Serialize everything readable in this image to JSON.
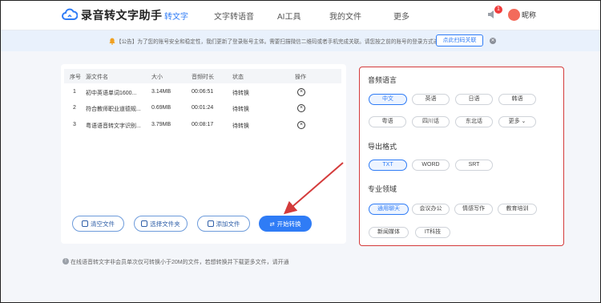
{
  "app": {
    "title": "录音转文字助手"
  },
  "nav": [
    "转文字",
    "文字转语音",
    "AI工具",
    "我的文件",
    "更多"
  ],
  "header": {
    "badge_count": "1",
    "nickname": "昵称"
  },
  "notice": {
    "text": "【公告】为了您的账号安全和稳定性，我们更新了登录账号主体。需要扫描微信二维码或者手机完成关联。请您按之前的账号的登录方式进行关联。",
    "button": "点此扫码关联"
  },
  "table": {
    "headers": [
      "序号",
      "源文件名",
      "大小",
      "音频时长",
      "状态",
      "操作"
    ],
    "rows": [
      {
        "index": "1",
        "name": "初中英语单词1600...",
        "size": "3.14MB",
        "duration": "00:06:51",
        "status": "待转换"
      },
      {
        "index": "2",
        "name": "符合教师职业道德规...",
        "size": "0.69MB",
        "duration": "00:01:24",
        "status": "待转换"
      },
      {
        "index": "3",
        "name": "粤语语音转文字识别...",
        "size": "3.79MB",
        "duration": "00:08:17",
        "status": "待转换"
      }
    ]
  },
  "actions": {
    "clear": "清空文件",
    "choose_folder": "选择文件夹",
    "add_file": "添加文件",
    "start": "开始转换"
  },
  "hint": "在线语音转文字非会员单次仅可转换小于20M的文件，若想转换并下载更多文件，请开通",
  "settings": {
    "language_title": "音频语言",
    "languages": [
      "中文",
      "英语",
      "日语",
      "韩语",
      "粤语",
      "四川话",
      "东北话",
      "更多"
    ],
    "selected_language": "中文",
    "format_title": "导出格式",
    "formats": [
      "TXT",
      "WORD",
      "SRT"
    ],
    "selected_format": "TXT",
    "domain_title": "专业领域",
    "domains": [
      "通用聊天",
      "会议办公",
      "情感写作",
      "教育培训",
      "新闻媒体",
      "IT科技"
    ],
    "selected_domain": "通用聊天"
  },
  "colors": {
    "accent": "#2f7cf6",
    "highlight_border": "#d43b3b",
    "arrow": "#d43b3b"
  }
}
